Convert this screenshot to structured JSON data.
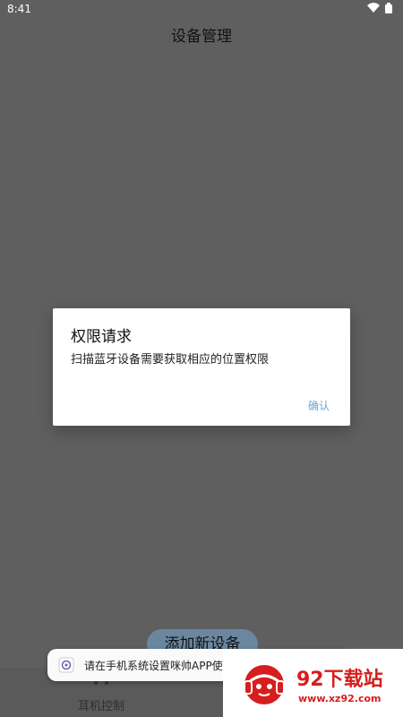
{
  "status_bar": {
    "time": "8:41"
  },
  "header": {
    "title": "设备管理"
  },
  "dialog": {
    "title": "权限请求",
    "message": "扫描蓝牙设备需要获取相应的位置权限",
    "confirm_label": "确认"
  },
  "main": {
    "add_device_label": "添加新设备"
  },
  "bottom_nav": {
    "items": [
      {
        "label": "耳机控制"
      }
    ]
  },
  "toast": {
    "text": "请在手机系统设置咪帅APP使用"
  },
  "watermark": {
    "title": "92下载站",
    "url": "www.xz92.com"
  },
  "colors": {
    "accent": "#6aa6d8",
    "brand_red": "#d61e1e",
    "button": "#6b879f"
  }
}
